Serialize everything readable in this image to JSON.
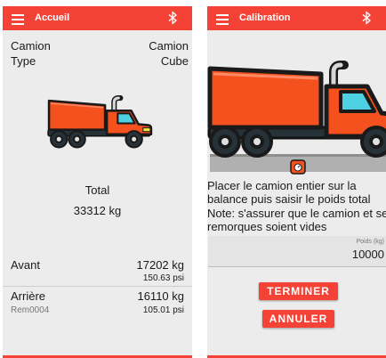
{
  "left": {
    "appbar": {
      "title": "Accueil",
      "menu_icon": "menu-icon",
      "bluetooth_icon": "bluetooth-icon"
    },
    "header": {
      "left_line1": "Camion",
      "left_line2": "Type",
      "right_line1": "Camion",
      "right_line2": "Cube"
    },
    "total_label": "Total",
    "total_value": "33312 kg",
    "front": {
      "label": "Avant",
      "weight": "17202 kg",
      "pressure": "150.63 psi"
    },
    "rear": {
      "label": "Arrière",
      "sub": "Rem0004",
      "weight": "16110 kg",
      "pressure": "105.01 psi"
    }
  },
  "right": {
    "appbar": {
      "title": "Calibration",
      "menu_icon": "menu-icon",
      "bluetooth_icon": "bluetooth-icon"
    },
    "instruction": "Placer le camion entier sur la balance puis saisir le poids total",
    "note": "Note: s'assurer que le camion et ses remorques soient vides",
    "field_label": "Poids (kg)",
    "field_value": "10000",
    "finish_button": "TERMINER",
    "cancel_button": "ANNULER"
  },
  "colors": {
    "accent": "#f44336",
    "truck_body": "#f4511e",
    "screen_bg": "#ececec"
  }
}
